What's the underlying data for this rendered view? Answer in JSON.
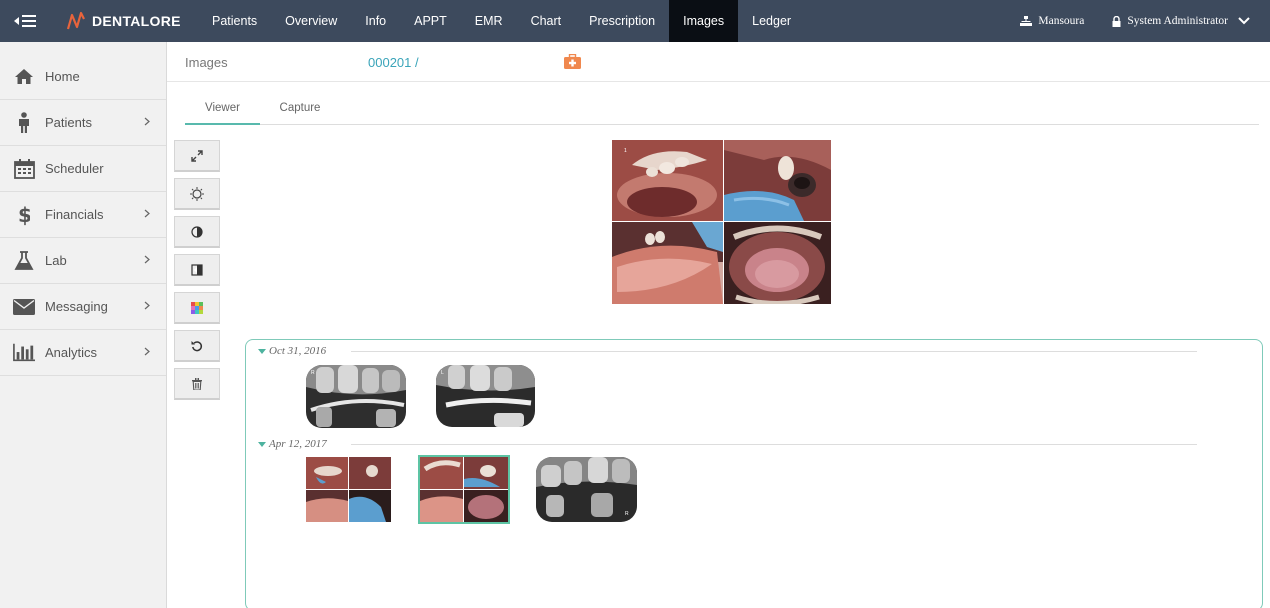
{
  "app": {
    "brand": "DENTALORE"
  },
  "nav": {
    "tabs": [
      "Patients",
      "Overview",
      "Info",
      "APPT",
      "EMR",
      "Chart",
      "Prescription",
      "Images",
      "Ledger"
    ],
    "active": "Images"
  },
  "user": {
    "location": "Mansoura",
    "name": "System Administrator"
  },
  "sidebar": {
    "items": [
      {
        "label": "Home",
        "icon": "home-icon"
      },
      {
        "label": "Patients",
        "icon": "person-icon"
      },
      {
        "label": "Scheduler",
        "icon": "calendar-icon"
      },
      {
        "label": "Financials",
        "icon": "dollar-icon"
      },
      {
        "label": "Lab",
        "icon": "flask-icon"
      },
      {
        "label": "Messaging",
        "icon": "envelope-icon"
      },
      {
        "label": "Analytics",
        "icon": "bar-chart-icon"
      }
    ]
  },
  "header": {
    "title": "Images",
    "patient_id": "000201 /"
  },
  "subtabs": {
    "viewer": "Viewer",
    "capture": "Capture",
    "active": "Viewer"
  },
  "tools": [
    "expand-icon",
    "brightness-icon",
    "contrast-icon",
    "invert-icon",
    "color-palette-icon",
    "reset-icon",
    "trash-icon"
  ],
  "gallery": {
    "groups": [
      {
        "date": "Oct 31, 2016",
        "images": [
          "xray",
          "xray"
        ]
      },
      {
        "date": "Apr 12, 2017",
        "images": [
          "intraoral-grid",
          "intraoral-grid",
          "xray"
        ]
      }
    ]
  },
  "colors": {
    "topbar": "#3d4a5d",
    "active_tab": "#0a0e14",
    "accent": "#58b9ad",
    "link": "#3aa4b9",
    "kit": "#f0884e"
  }
}
